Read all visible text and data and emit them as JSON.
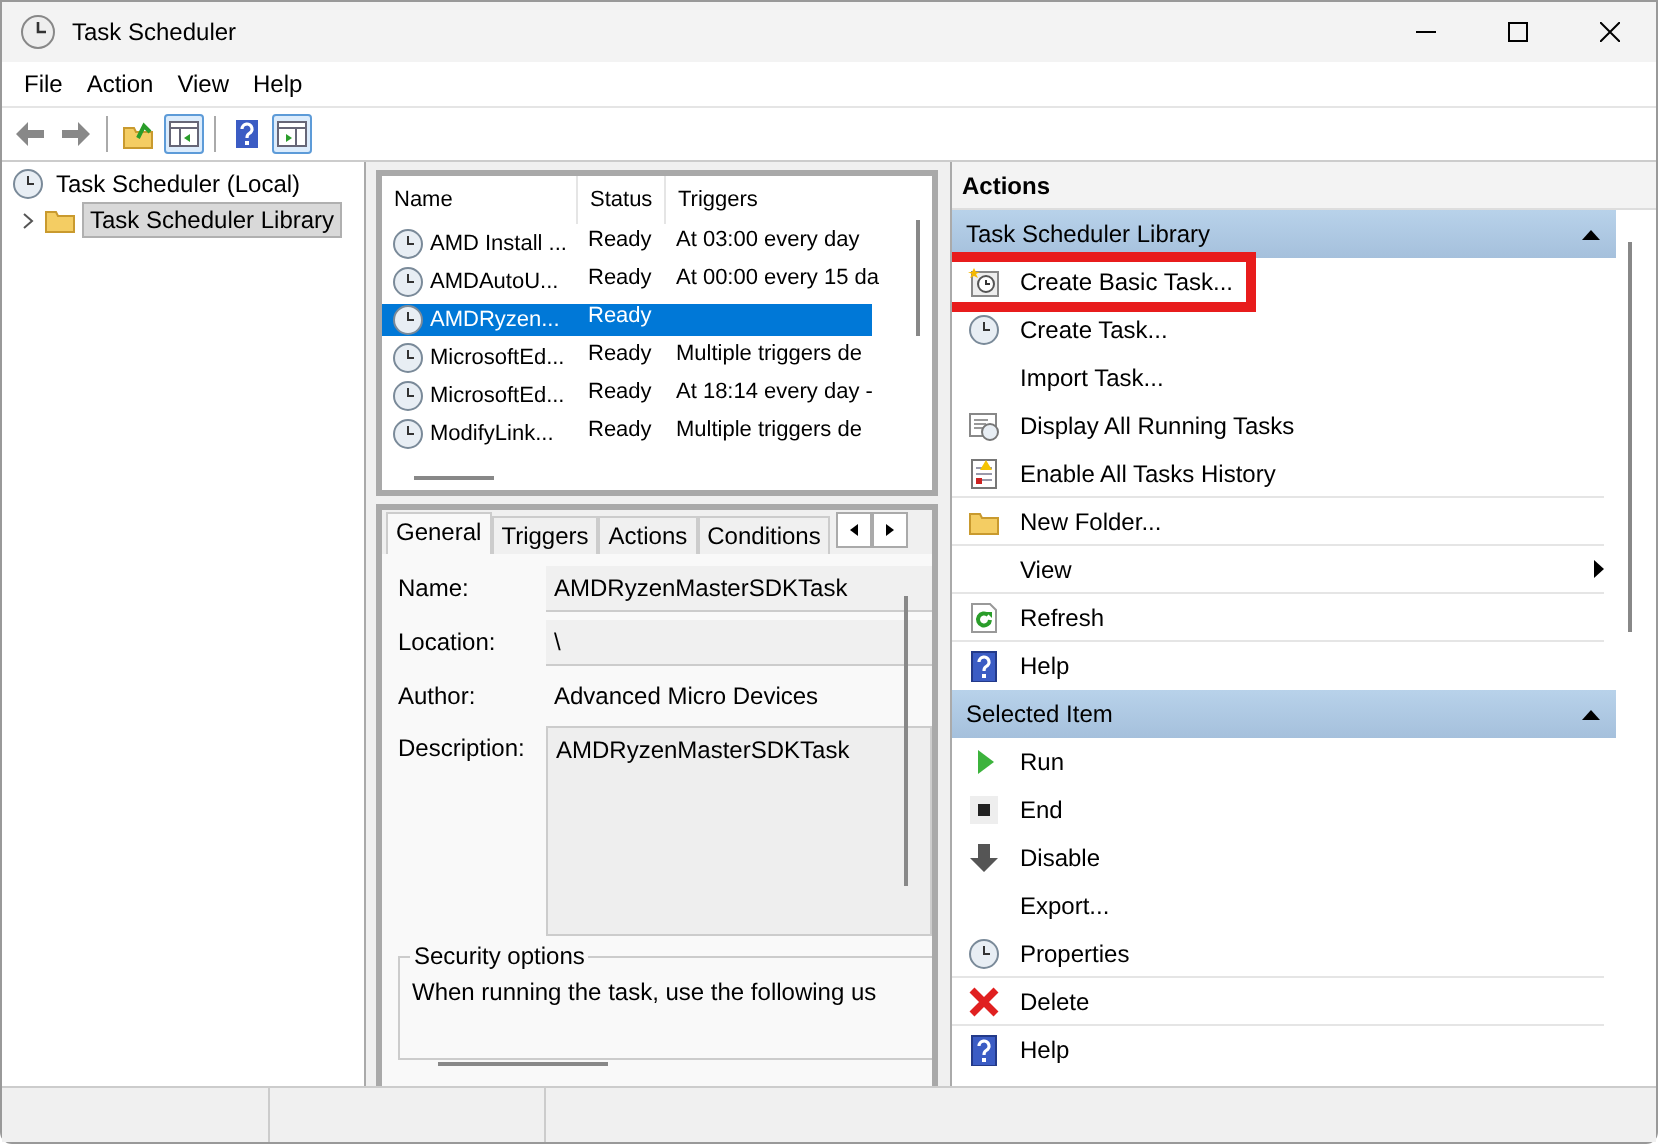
{
  "window": {
    "title": "Task Scheduler"
  },
  "menu": [
    "File",
    "Action",
    "View",
    "Help"
  ],
  "tree": {
    "items": [
      {
        "label": "Task Scheduler (Local)",
        "selected": false,
        "children": [
          {
            "label": "Task Scheduler Library",
            "selected": true,
            "expanded": false
          }
        ]
      }
    ]
  },
  "task_list": {
    "columns": [
      "Name",
      "Status",
      "Triggers"
    ],
    "rows": [
      {
        "name": "AMD Install ...",
        "status": "Ready",
        "triggers": "At 03:00 every day",
        "selected": false
      },
      {
        "name": "AMDAutoU...",
        "status": "Ready",
        "triggers": "At 00:00 every 15 da",
        "selected": false
      },
      {
        "name": "AMDRyzen...",
        "status": "Ready",
        "triggers": "",
        "selected": true
      },
      {
        "name": "MicrosoftEd...",
        "status": "Ready",
        "triggers": "Multiple triggers de",
        "selected": false
      },
      {
        "name": "MicrosoftEd...",
        "status": "Ready",
        "triggers": "At 18:14 every day -",
        "selected": false
      },
      {
        "name": "ModifyLink...",
        "status": "Ready",
        "triggers": "Multiple triggers de",
        "selected": false
      }
    ]
  },
  "details": {
    "tabs": [
      {
        "label": "General",
        "selected": true
      },
      {
        "label": "Triggers",
        "selected": false
      },
      {
        "label": "Actions",
        "selected": false
      },
      {
        "label": "Conditions",
        "selected": false
      }
    ],
    "fields": [
      {
        "label": "Name:",
        "value": "AMDRyzenMasterSDKTask",
        "kind": "field"
      },
      {
        "label": "Location:",
        "value": "\\",
        "kind": "field"
      },
      {
        "label": "Author:",
        "value": "Advanced Micro Devices",
        "kind": "text"
      },
      {
        "label": "Description:",
        "value": "AMDRyzenMasterSDKTask",
        "kind": "area"
      }
    ],
    "security": {
      "title": "Security options",
      "text": "When running the task, use the following us"
    }
  },
  "actions": {
    "title": "Actions",
    "sections": [
      {
        "title": "Task Scheduler Library",
        "expanded": true,
        "items": [
          {
            "label": "Create Basic Task...",
            "highlighted": true
          },
          {
            "label": "Create Task...",
            "highlighted": false
          },
          {
            "label": "Import Task...",
            "highlighted": false
          },
          {
            "label": "Display All Running Tasks",
            "highlighted": false
          },
          {
            "label": "Enable All Tasks History",
            "highlighted": false
          },
          {
            "label": "New Folder...",
            "highlighted": false
          },
          {
            "label": "View",
            "highlighted": false
          },
          {
            "label": "Refresh",
            "highlighted": false
          },
          {
            "label": "Help",
            "highlighted": false
          }
        ]
      },
      {
        "title": "Selected Item",
        "expanded": true,
        "items": [
          {
            "label": "Run",
            "highlighted": false
          },
          {
            "label": "End",
            "highlighted": false
          },
          {
            "label": "Disable",
            "highlighted": false
          },
          {
            "label": "Export...",
            "highlighted": false
          },
          {
            "label": "Properties",
            "highlighted": false
          },
          {
            "label": "Delete",
            "highlighted": false
          },
          {
            "label": "Help",
            "highlighted": false
          }
        ]
      }
    ]
  }
}
